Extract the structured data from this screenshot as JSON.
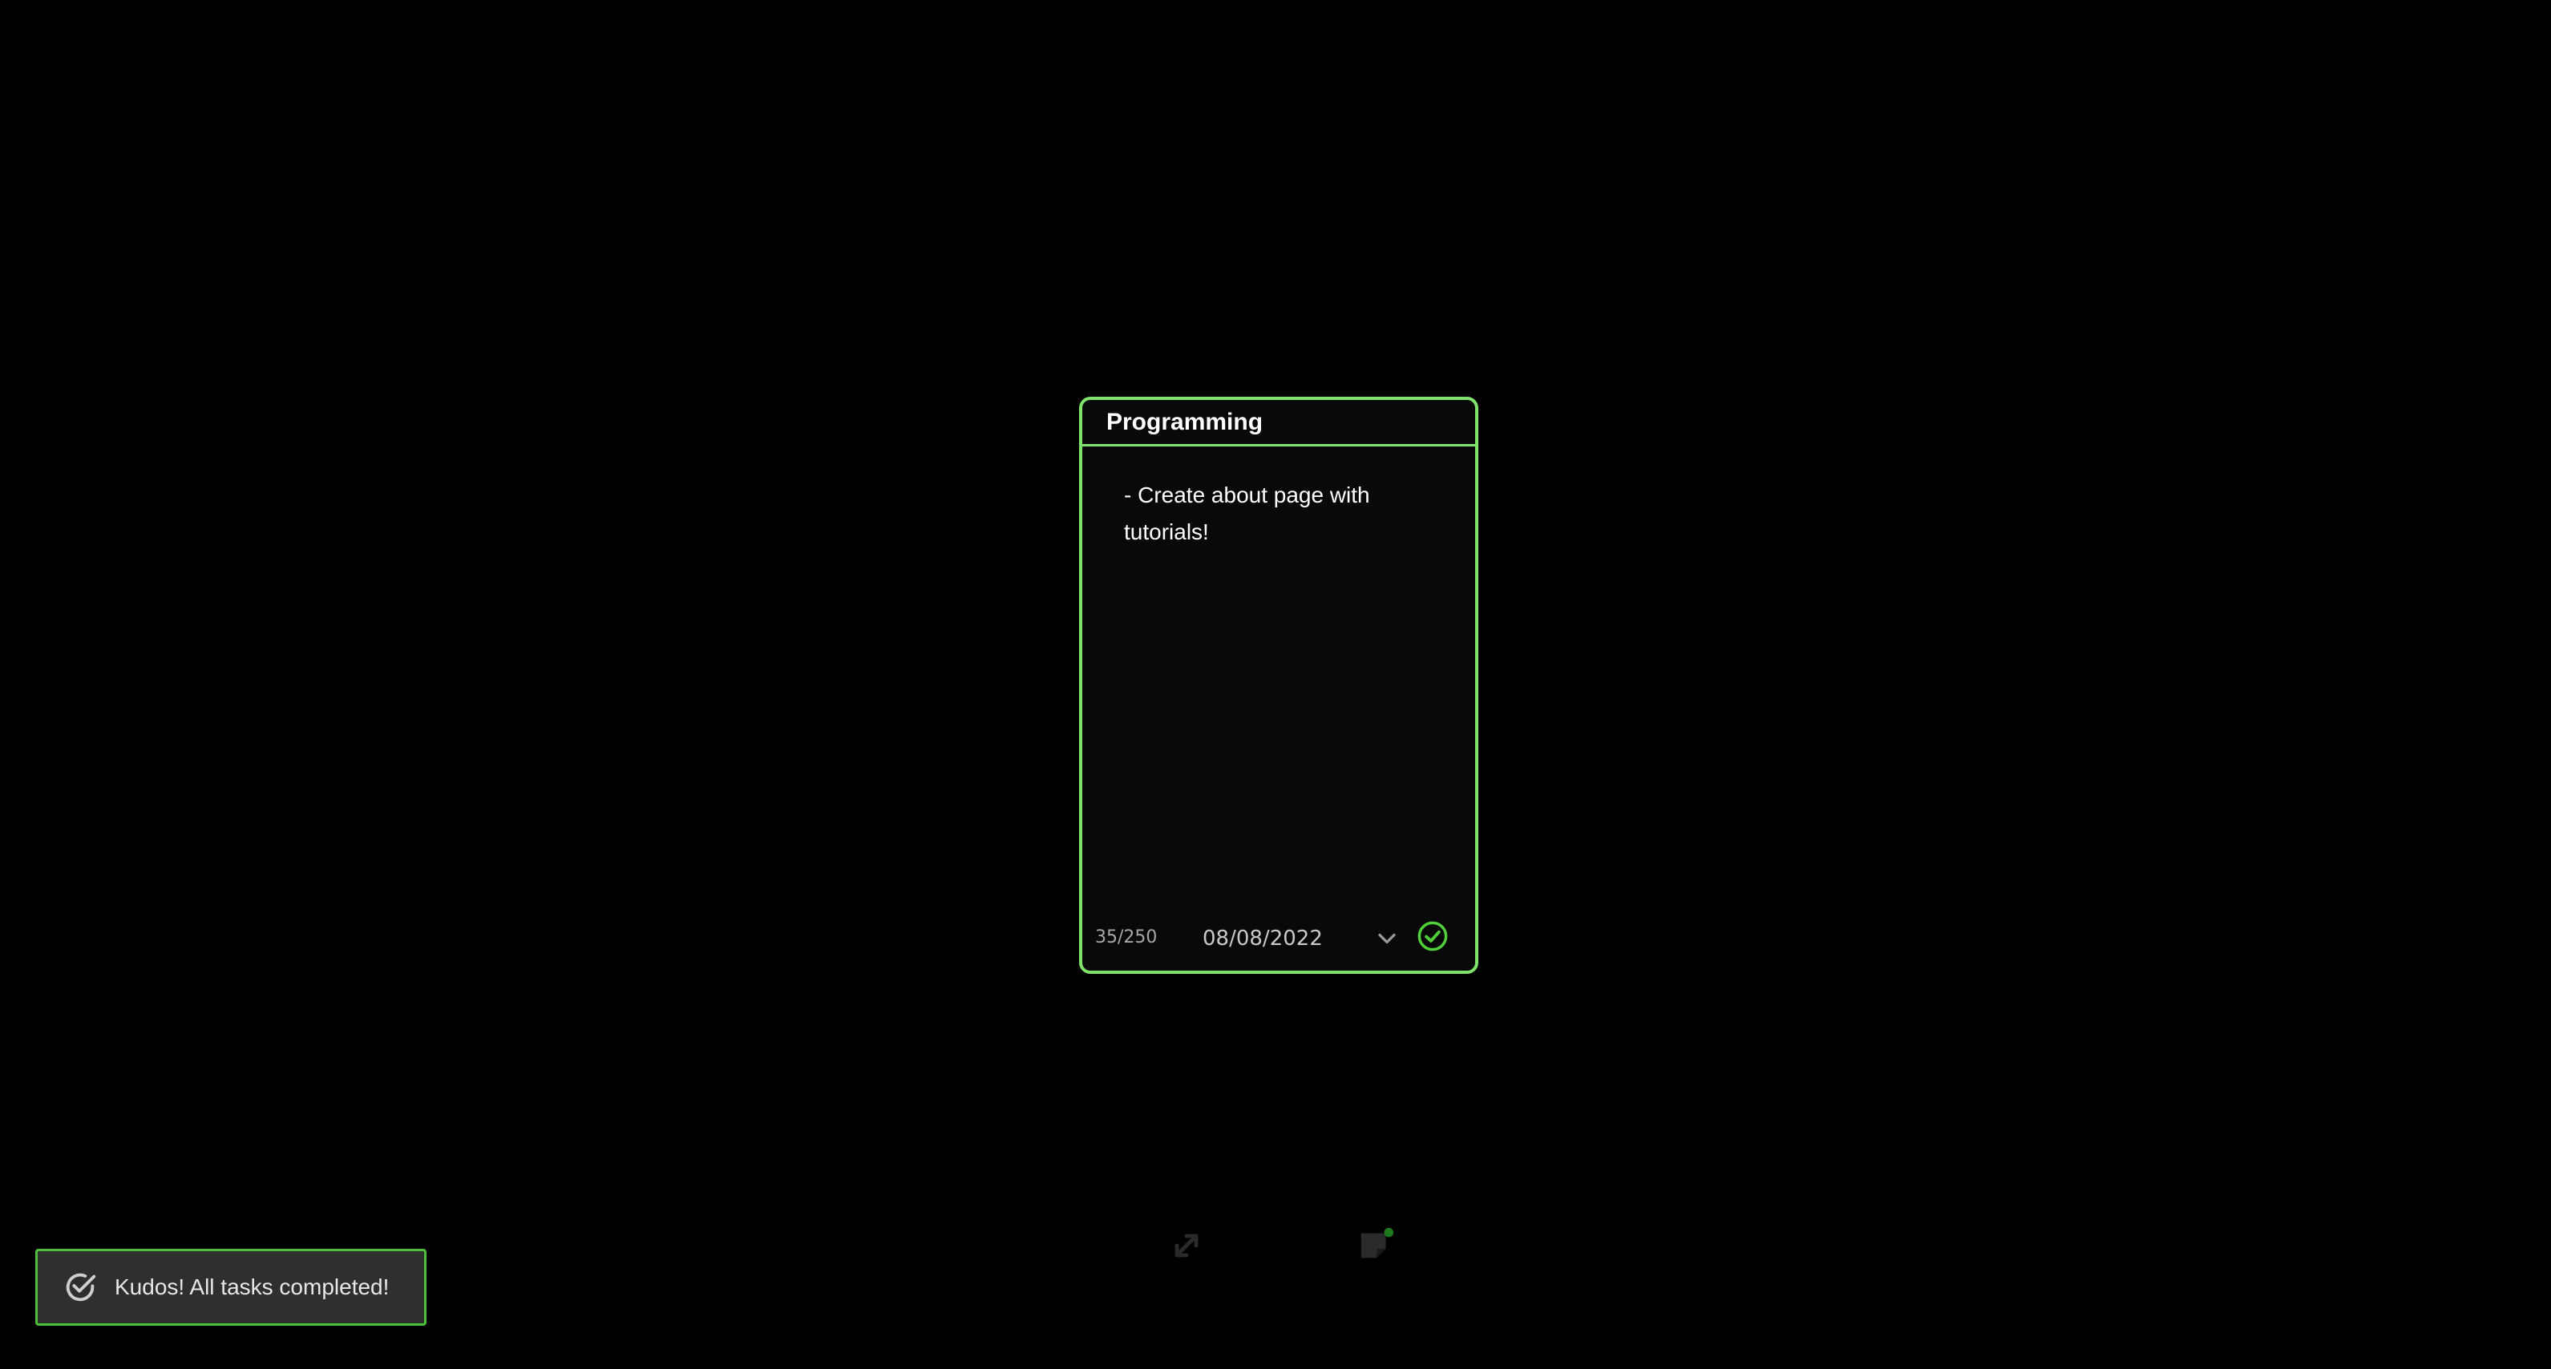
{
  "note": {
    "title": "Programming",
    "content": "- Create about page with\ntutorials!",
    "char_count": "35/250",
    "date": "08/08/2022",
    "border_color": "#7fe36a"
  },
  "toolbar": {
    "expand_icon": "expand-icon",
    "note_icon": "sticky-note-icon"
  },
  "toast": {
    "message": "Kudos! All tasks completed!",
    "icon": "check-circle-icon",
    "border_color": "#4fbf3a"
  }
}
